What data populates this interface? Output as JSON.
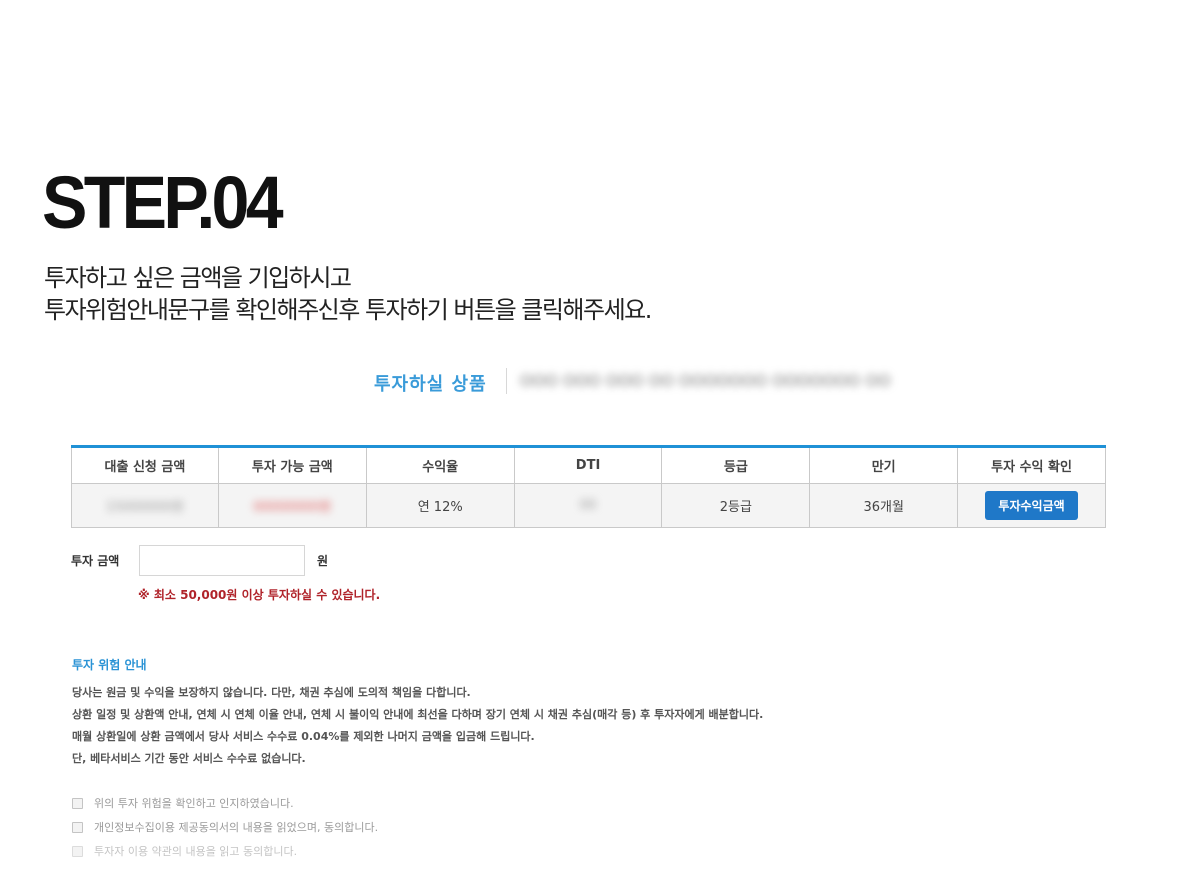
{
  "step": {
    "title": "STEP.04",
    "desc_line1": "투자하고 싶은 금액을 기입하시고",
    "desc_line2": "투자위험안내문구를 확인해주신후 투자하기 버튼을 클릭해주세요."
  },
  "product": {
    "label": "투자하실 상품",
    "name": "OOO OOO OOO OO OOOOOOO OOOOOOO OO"
  },
  "table": {
    "headers": [
      "대출 신청 금액",
      "투자 가능 금액",
      "수익율",
      "DTI",
      "등급",
      "만기",
      "투자 수익 확인"
    ],
    "row": {
      "loan_amount": "15000000원",
      "available_amount": "00000000원",
      "rate": "연 12%",
      "dti": "00",
      "grade": "2등급",
      "term": "36개월",
      "calc_button": "투자수익금액"
    }
  },
  "amount": {
    "label": "투자 금액",
    "value": "",
    "unit": "원",
    "note": "※ 최소 50,000원 이상 투자하실 수 있습니다."
  },
  "risk": {
    "title": "투자 위험 안내",
    "lines": [
      "당사는 원금 및 수익을 보장하지 않습니다. 다만, 채권 추심에 도의적 책임을 다합니다.",
      "상환 일정 및 상환액 안내, 연체 시 연체 이율 안내, 연체 시 불이익 안내에 최선을 다하며 장기 연체 시 채권 추심(매각 등) 후 투자자에게 배분합니다.",
      "매월 상환일에 상환 금액에서 당사 서비스 수수료 0.04%를 제외한 나머지 금액을 입금해 드립니다.",
      "단, 베타서비스 기간 동안 서비스 수수료 없습니다."
    ]
  },
  "agreements": [
    "위의 투자 위험을 확인하고 인지하였습니다.",
    "개인정보수집이용 제공동의서의 내용을 읽었으며, 동의합니다.",
    "투자자 이용 약관의 내용을 읽고 동의합니다."
  ],
  "colors": {
    "accent": "#1f91d6",
    "button": "#1f78c8",
    "warning": "#b0232a"
  }
}
